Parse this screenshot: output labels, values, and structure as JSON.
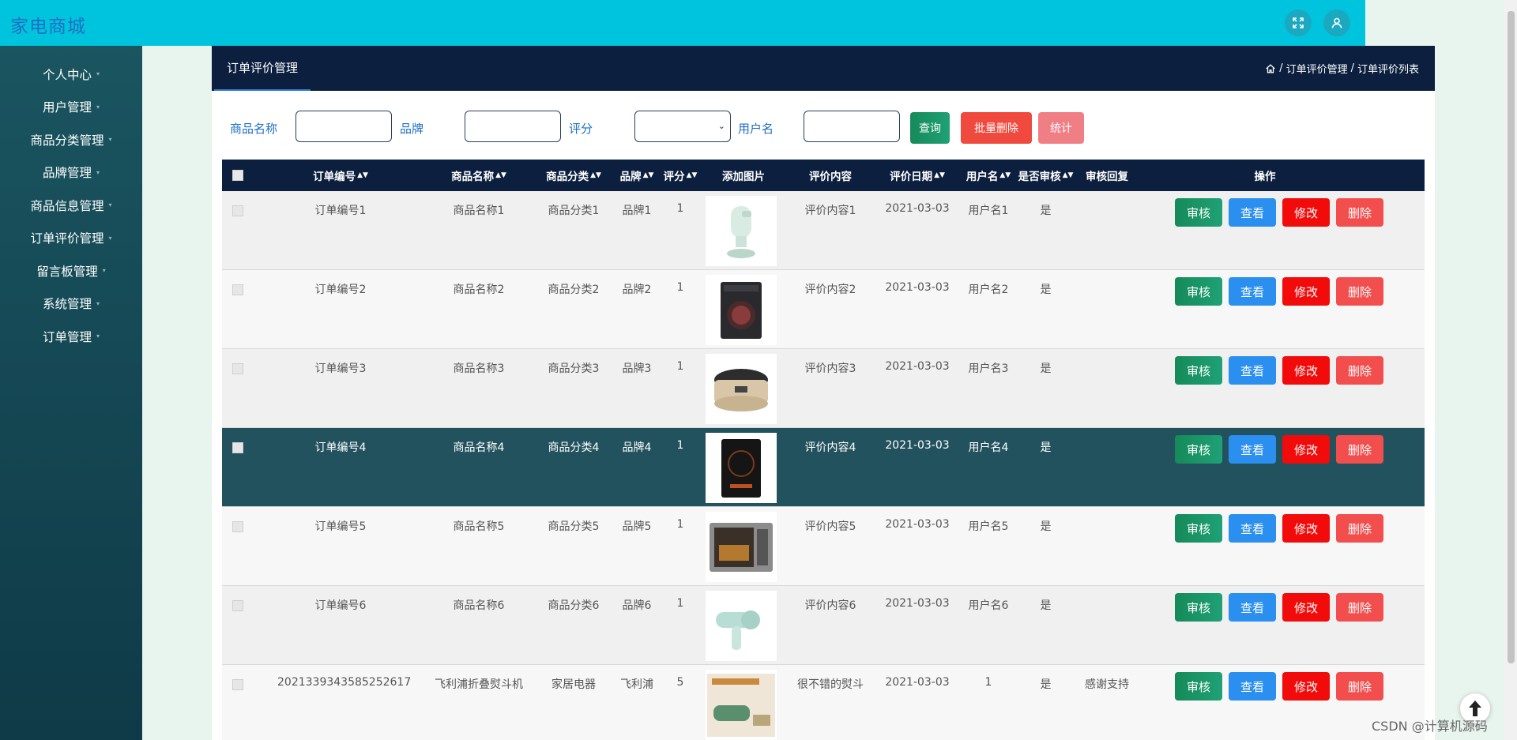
{
  "app": {
    "title": "家电商城"
  },
  "sidebar": {
    "items": [
      {
        "label": "个人中心"
      },
      {
        "label": "用户管理"
      },
      {
        "label": "商品分类管理"
      },
      {
        "label": "品牌管理"
      },
      {
        "label": "商品信息管理"
      },
      {
        "label": "订单评价管理"
      },
      {
        "label": "留言板管理"
      },
      {
        "label": "系统管理"
      },
      {
        "label": "订单管理"
      }
    ]
  },
  "panel": {
    "tab": "订单评价管理",
    "breadcrumb": [
      "订单评价管理",
      "订单评价列表"
    ],
    "breadcrumb_sep": "/"
  },
  "filters": {
    "name_label": "商品名称",
    "brand_label": "品牌",
    "score_label": "评分",
    "user_label": "用户名",
    "search_btn": "查询",
    "batch_delete_btn": "批量删除",
    "stats_btn": "统计"
  },
  "table": {
    "headers": [
      "订单编号",
      "商品名称",
      "商品分类",
      "品牌",
      "评分",
      "添加图片",
      "评价内容",
      "评价日期",
      "用户名",
      "是否审核",
      "审核回复",
      "操作"
    ],
    "actions": {
      "audit": "审核",
      "view": "查看",
      "edit": "修改",
      "delete": "删除"
    },
    "rows": [
      {
        "order": "订单编号1",
        "name": "商品名称1",
        "category": "商品分类1",
        "brand": "品牌1",
        "score": "1",
        "image": "steamer",
        "content": "评价内容1",
        "date": "2021-03-03",
        "user": "用户名1",
        "audited": "是",
        "reply": ""
      },
      {
        "order": "订单编号2",
        "name": "商品名称2",
        "category": "商品分类2",
        "brand": "品牌2",
        "score": "1",
        "image": "washer",
        "content": "评价内容2",
        "date": "2021-03-03",
        "user": "用户名2",
        "audited": "是",
        "reply": ""
      },
      {
        "order": "订单编号3",
        "name": "商品名称3",
        "category": "商品分类3",
        "brand": "品牌3",
        "score": "1",
        "image": "rice-cooker",
        "content": "评价内容3",
        "date": "2021-03-03",
        "user": "用户名3",
        "audited": "是",
        "reply": ""
      },
      {
        "order": "订单编号4",
        "name": "商品名称4",
        "category": "商品分类4",
        "brand": "品牌4",
        "score": "1",
        "image": "induction-cooker",
        "content": "评价内容4",
        "date": "2021-03-03",
        "user": "用户名4",
        "audited": "是",
        "reply": ""
      },
      {
        "order": "订单编号5",
        "name": "商品名称5",
        "category": "商品分类5",
        "brand": "品牌5",
        "score": "1",
        "image": "microwave",
        "content": "评价内容5",
        "date": "2021-03-03",
        "user": "用户名5",
        "audited": "是",
        "reply": ""
      },
      {
        "order": "订单编号6",
        "name": "商品名称6",
        "category": "商品分类6",
        "brand": "品牌6",
        "score": "1",
        "image": "hair-dryer",
        "content": "评价内容6",
        "date": "2021-03-03",
        "user": "用户名6",
        "audited": "是",
        "reply": ""
      },
      {
        "order": "2021339343585252617",
        "name": "飞利浦折叠熨斗机",
        "category": "家居电器",
        "brand": "飞利浦",
        "score": "5",
        "image": "iron-ad",
        "content": "很不错的熨斗",
        "date": "2021-03-03",
        "user": "1",
        "audited": "是",
        "reply": "感谢支持"
      }
    ]
  },
  "watermark": "CSDN @计算机源码",
  "colors": {
    "topbar": "#00c4dd",
    "header": "#0c1f3f",
    "active_row": "#23525f"
  }
}
